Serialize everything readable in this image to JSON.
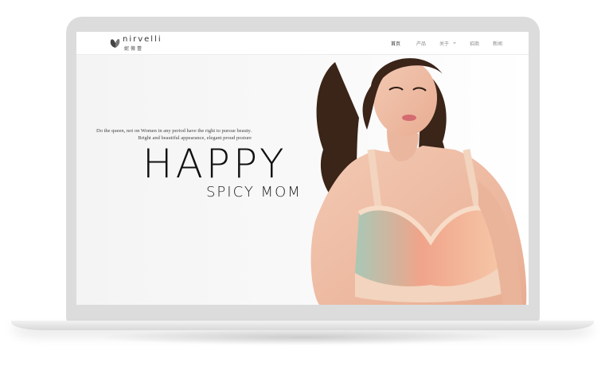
{
  "brand": {
    "name": "nirvelli",
    "chinese_name": "妮薇蕾",
    "logo_icon": "butterfly-icon"
  },
  "nav": {
    "items": [
      {
        "label": "首页",
        "active": true
      },
      {
        "label": "产品",
        "active": false
      },
      {
        "label": "关于",
        "active": false,
        "has_dropdown": true
      },
      {
        "label": "招商",
        "active": false
      },
      {
        "label": "新闻",
        "active": false
      }
    ]
  },
  "hero": {
    "tagline_line1": "Do the queen, not on Women in any period have the right to pursue beauty.",
    "tagline_line2": "Bright and beautiful appearance, elegant proud posture",
    "headline": "HAPPY",
    "subheadline": "SPICY MOM"
  },
  "colors": {
    "frame": "#dcdcdc",
    "nav_active": "#333333",
    "nav_inactive": "#888888",
    "headline": "#111111"
  }
}
